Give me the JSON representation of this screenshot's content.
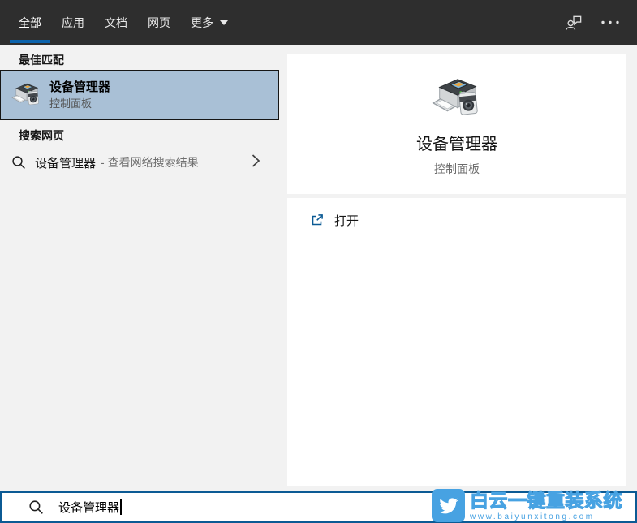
{
  "topbar": {
    "tabs": [
      {
        "label": "全部",
        "active": true
      },
      {
        "label": "应用",
        "active": false
      },
      {
        "label": "文档",
        "active": false
      },
      {
        "label": "网页",
        "active": false
      },
      {
        "label": "更多",
        "active": false,
        "has_dropdown": true
      }
    ]
  },
  "left_panel": {
    "best_match_section": "最佳匹配",
    "best_match": {
      "title": "设备管理器",
      "subtitle": "控制面板"
    },
    "web_section": "搜索网页",
    "web_item": {
      "query": "设备管理器",
      "hint": "- 查看网络搜索结果"
    }
  },
  "preview": {
    "title": "设备管理器",
    "subtitle": "控制面板",
    "open_label": "打开"
  },
  "search_bar": {
    "value": "设备管理器"
  },
  "watermark": {
    "brand": "白云一键重装系统",
    "url": "www.baiyunxitong.com"
  },
  "icons": {
    "feedback": "person-chat-icon",
    "more": "ellipsis-icon",
    "dropdown": "chevron-down-icon",
    "best_match": "device-manager-icon",
    "web_search": "search-icon",
    "web_chevron": "chevron-right-icon",
    "open": "open-external-icon",
    "watermark": "twitter-bird-icon"
  },
  "colors": {
    "topbar_bg": "#2e2e2e",
    "accent_underline": "#0c63ac",
    "panel_bg": "#f2f2f2",
    "highlight_bg": "#a9c0d6",
    "search_border": "#0b5a94",
    "open_icon": "#0b5a94",
    "watermark_blue": "#47a2e2"
  }
}
